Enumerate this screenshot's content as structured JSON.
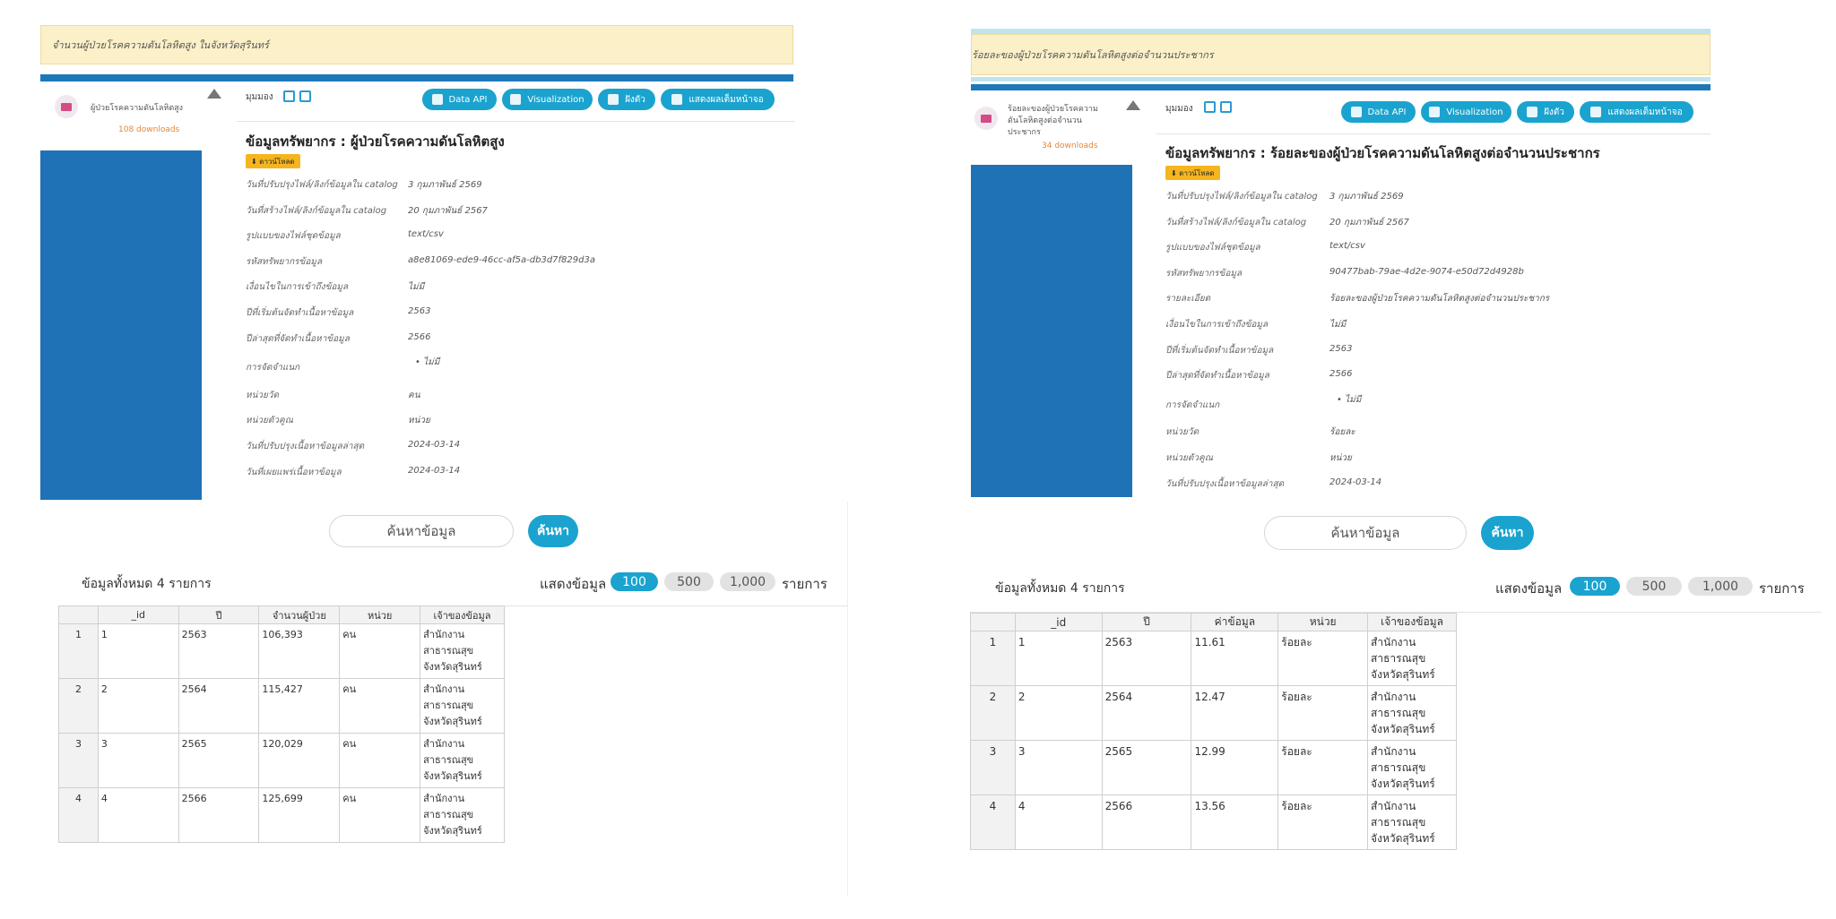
{
  "left": {
    "banner": "จำนวนผู้ป่วยโรคความดันโลหิตสูง ในจังหวัดสุรินทร์",
    "resource_name": "ผู้ป่วยโรคความดันโลหิตสูง",
    "downloads": "108 downloads",
    "view_label": "มุมมอง",
    "buttons": {
      "api": "Data API",
      "viz": "Visualization",
      "embed": "ฝังตัว",
      "full": "แสดงผลเต็มหน้าจอ"
    },
    "title": "ข้อมูลทรัพยากร : ผู้ป่วยโรคความดันโลหิตสูง",
    "download_label": "ดาวน์โหลด",
    "meta": [
      {
        "k": "วันที่ปรับปรุงไฟล์/ลิงก์ข้อมูลใน catalog",
        "v": "3 กุมภาพันธ์ 2569"
      },
      {
        "k": "วันที่สร้างไฟล์/ลิงก์ข้อมูลใน catalog",
        "v": "20 กุมภาพันธ์ 2567"
      },
      {
        "k": "รูปแบบของไฟล์ชุดข้อมูล",
        "v": "text/csv"
      },
      {
        "k": "รหัสทรัพยากรข้อมูล",
        "v": "a8e81069-ede9-46cc-af5a-db3d7f829d3a"
      },
      {
        "k": "เงื่อนไขในการเข้าถึงข้อมูล",
        "v": "ไม่มี"
      },
      {
        "k": "ปีที่เริ่มต้นจัดทำเนื้อหาข้อมูล",
        "v": "2563"
      },
      {
        "k": "ปีล่าสุดที่จัดทำเนื้อหาข้อมูล",
        "v": "2566"
      },
      {
        "k": "การจัดจำแนก",
        "v": "• ไม่มี"
      },
      {
        "k": "หน่วยวัด",
        "v": "คน"
      },
      {
        "k": "หน่วยตัวคูณ",
        "v": "หน่วย"
      },
      {
        "k": "วันที่ปรับปรุงเนื้อหาข้อมูลล่าสุด",
        "v": "2024-03-14"
      },
      {
        "k": "วันที่เผยแพร่เนื้อหาข้อมูล",
        "v": "2024-03-14"
      }
    ],
    "search_placeholder": "ค้นหาข้อมูล",
    "search_btn": "ค้นหา",
    "total": "ข้อมูลทั้งหมด 4 รายการ",
    "show_label": "แสดงข้อมูล",
    "page_sizes": [
      "100",
      "500",
      "1,000"
    ],
    "items_label": "รายการ",
    "columns": [
      "_id",
      "ปี",
      "จำนวนผู้ป่วย",
      "หน่วย",
      "เจ้าของข้อมูล"
    ],
    "rows": [
      {
        "n": "1",
        "id": "1",
        "year": "2563",
        "value": "106,393",
        "unit": "คน",
        "o1": "สำนักงาน",
        "o2": "สาธารณสุข",
        "o3": "จังหวัดสุรินทร์"
      },
      {
        "n": "2",
        "id": "2",
        "year": "2564",
        "value": "115,427",
        "unit": "คน",
        "o1": "สำนักงาน",
        "o2": "สาธารณสุข",
        "o3": "จังหวัดสุรินทร์"
      },
      {
        "n": "3",
        "id": "3",
        "year": "2565",
        "value": "120,029",
        "unit": "คน",
        "o1": "สำนักงาน",
        "o2": "สาธารณสุข",
        "o3": "จังหวัดสุรินทร์"
      },
      {
        "n": "4",
        "id": "4",
        "year": "2566",
        "value": "125,699",
        "unit": "คน",
        "o1": "สำนักงาน",
        "o2": "สาธารณสุข",
        "o3": "จังหวัดสุรินทร์"
      }
    ]
  },
  "right": {
    "banner": "ร้อยละของผู้ป่วยโรคความดันโลหิตสูงต่อจำนวนประชากร",
    "resource_name_1": "ร้อยละของผู้ป่วยโรคความ",
    "resource_name_2": "ดันโลหิตสูงต่อจำนวน",
    "resource_name_3": "ประชากร",
    "downloads": "34 downloads",
    "view_label": "มุมมอง",
    "buttons": {
      "api": "Data API",
      "viz": "Visualization",
      "embed": "ฝังตัว",
      "full": "แสดงผลเต็มหน้าจอ"
    },
    "title": "ข้อมูลทรัพยากร : ร้อยละของผู้ป่วยโรคความดันโลหิตสูงต่อจำนวนประชากร",
    "download_label": "ดาวน์โหลด",
    "meta": [
      {
        "k": "วันที่ปรับปรุงไฟล์/ลิงก์ข้อมูลใน catalog",
        "v": "3 กุมภาพันธ์ 2569"
      },
      {
        "k": "วันที่สร้างไฟล์/ลิงก์ข้อมูลใน catalog",
        "v": "20 กุมภาพันธ์ 2567"
      },
      {
        "k": "รูปแบบของไฟล์ชุดข้อมูล",
        "v": "text/csv"
      },
      {
        "k": "รหัสทรัพยากรข้อมูล",
        "v": "90477bab-79ae-4d2e-9074-e50d72d4928b"
      },
      {
        "k": "รายละเอียด",
        "v": "ร้อยละของผู้ป่วยโรคความดันโลหิตสูงต่อจำนวนประชากร"
      },
      {
        "k": "เงื่อนไขในการเข้าถึงข้อมูล",
        "v": "ไม่มี"
      },
      {
        "k": "ปีที่เริ่มต้นจัดทำเนื้อหาข้อมูล",
        "v": "2563"
      },
      {
        "k": "ปีล่าสุดที่จัดทำเนื้อหาข้อมูล",
        "v": "2566"
      },
      {
        "k": "การจัดจำแนก",
        "v": "• ไม่มี"
      },
      {
        "k": "หน่วยวัด",
        "v": "ร้อยละ"
      },
      {
        "k": "หน่วยตัวคูณ",
        "v": "หน่วย"
      },
      {
        "k": "วันที่ปรับปรุงเนื้อหาข้อมูลล่าสุด",
        "v": "2024-03-14"
      }
    ],
    "search_placeholder": "ค้นหาข้อมูล",
    "search_btn": "ค้นหา",
    "total": "ข้อมูลทั้งหมด 4 รายการ",
    "show_label": "แสดงข้อมูล",
    "page_sizes": [
      "100",
      "500",
      "1,000"
    ],
    "items_label": "รายการ",
    "columns": [
      "_id",
      "ปี",
      "ค่าข้อมูล",
      "หน่วย",
      "เจ้าของข้อมูล"
    ],
    "rows": [
      {
        "n": "1",
        "id": "1",
        "year": "2563",
        "value": "11.61",
        "unit": "ร้อยละ",
        "o1": "สำนักงาน",
        "o2": "สาธารณสุข",
        "o3": "จังหวัดสุรินทร์"
      },
      {
        "n": "2",
        "id": "2",
        "year": "2564",
        "value": "12.47",
        "unit": "ร้อยละ",
        "o1": "สำนักงาน",
        "o2": "สาธารณสุข",
        "o3": "จังหวัดสุรินทร์"
      },
      {
        "n": "3",
        "id": "3",
        "year": "2565",
        "value": "12.99",
        "unit": "ร้อยละ",
        "o1": "สำนักงาน",
        "o2": "สาธารณสุข",
        "o3": "จังหวัดสุรินทร์"
      },
      {
        "n": "4",
        "id": "4",
        "year": "2566",
        "value": "13.56",
        "unit": "ร้อยละ",
        "o1": "สำนักงาน",
        "o2": "สาธารณสุข",
        "o3": "จังหวัดสุรินทร์"
      }
    ]
  },
  "colors": {
    "accent": "#1aa3cf",
    "brand_blue": "#1f72b6",
    "banner": "#fbf0c8",
    "download": "#f5b51f"
  }
}
